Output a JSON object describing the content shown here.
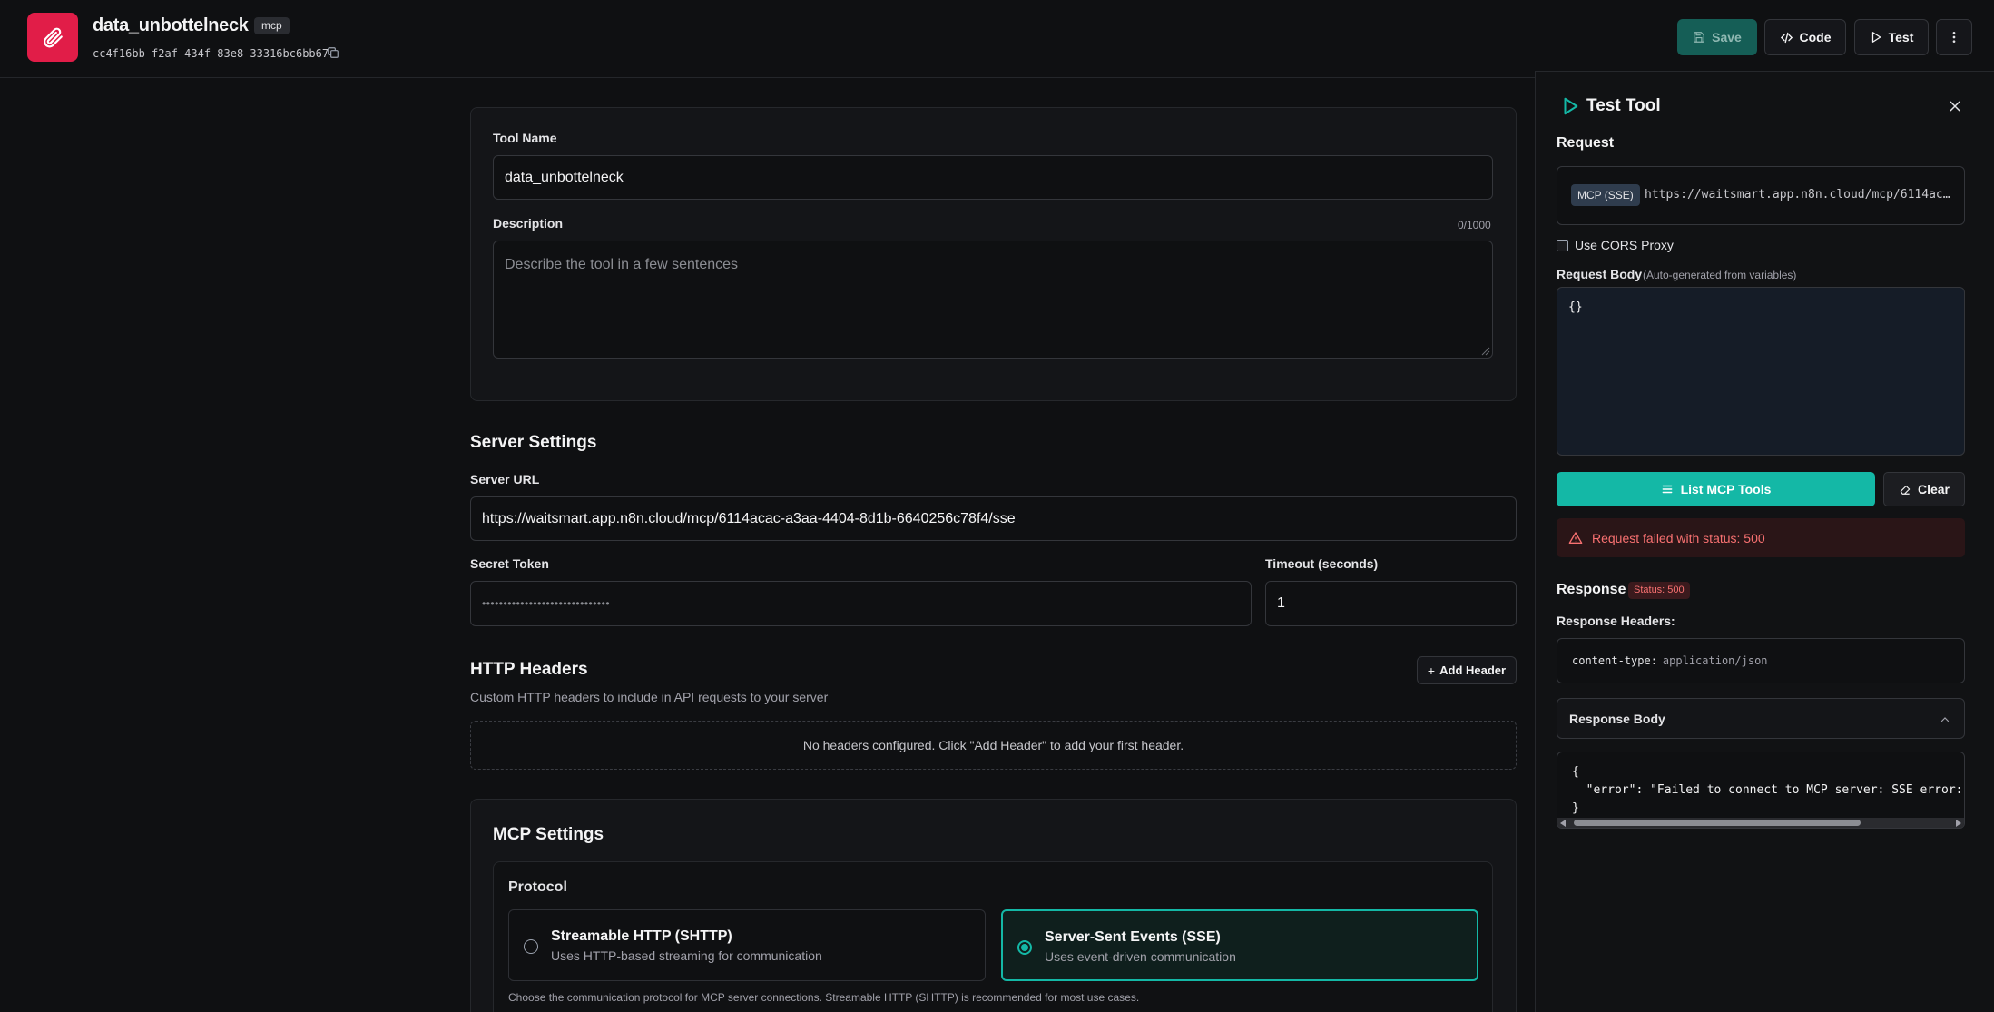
{
  "header": {
    "title": "data_unbottelneck",
    "badge": "mcp",
    "id": "cc4f16bb-f2af-434f-83e8-33316bc6bb67",
    "save_label": "Save",
    "code_label": "Code",
    "test_label": "Test"
  },
  "tool": {
    "name_label": "Tool Name",
    "name_value": "data_unbottelneck",
    "description_label": "Description",
    "description_counter": "0/1000",
    "description_placeholder": "Describe the tool in a few sentences"
  },
  "server": {
    "section_title": "Server Settings",
    "url_label": "Server URL",
    "url_value": "https://waitsmart.app.n8n.cloud/mcp/6114acac-a3aa-4404-8d1b-6640256c78f4/sse",
    "token_label": "Secret Token",
    "token_value": "••••••••••••••••••••••••••••••",
    "timeout_label": "Timeout (seconds)",
    "timeout_value": "1"
  },
  "headers": {
    "section_title": "HTTP Headers",
    "subtitle": "Custom HTTP headers to include in API requests to your server",
    "add_label": "Add Header",
    "empty_text": "No headers configured. Click \"Add Header\" to add your first header."
  },
  "mcp": {
    "section_title": "MCP Settings",
    "protocol_label": "Protocol",
    "options": [
      {
        "title": "Streamable HTTP (SHTTP)",
        "desc": "Uses HTTP-based streaming for communication",
        "selected": false
      },
      {
        "title": "Server-Sent Events (SSE)",
        "desc": "Uses event-driven communication",
        "selected": true
      }
    ],
    "hint": "Choose the communication protocol for MCP server connections. Streamable HTTP (SHTTP) is recommended for most use cases."
  },
  "test_panel": {
    "title": "Test Tool",
    "request_label": "Request",
    "method_badge": "MCP (SSE)",
    "request_url": "https://waitsmart.app.n8n.cloud/mcp/6114ac…",
    "cors_label": "Use CORS Proxy",
    "body_label": "Request Body",
    "body_hint": "(Auto-generated from variables)",
    "body_value": "{}",
    "list_tools_label": "List MCP Tools",
    "clear_label": "Clear",
    "error_text": "Request failed with status: 500",
    "response_label": "Response",
    "status_badge": "Status: 500",
    "response_headers_label": "Response Headers:",
    "header_key": "content-type:",
    "header_value": "application/json",
    "response_body_label": "Response Body",
    "body_line1": "{",
    "body_line2": "  \"error\": \"Failed to connect to MCP server: SSE error:",
    "body_line3": "}"
  },
  "colors": {
    "accent": "#14b8a6",
    "danger": "#e11d48",
    "error_bg": "#2a1517"
  }
}
